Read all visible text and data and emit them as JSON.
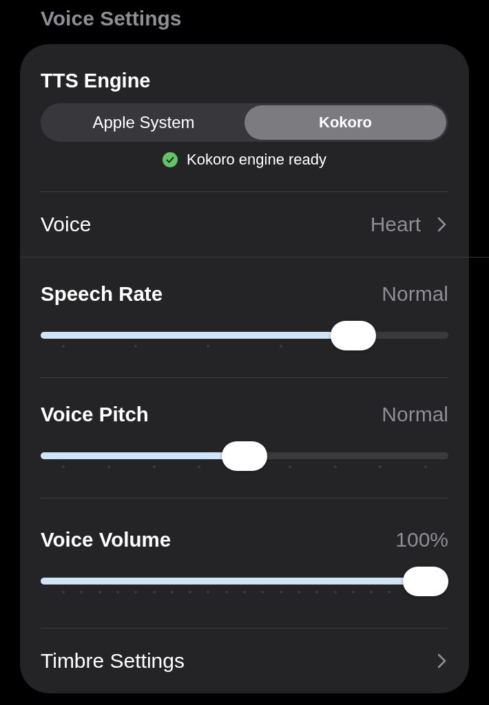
{
  "header": {
    "title": "Voice Settings"
  },
  "engine": {
    "label": "TTS Engine",
    "options": [
      {
        "label": "Apple System",
        "selected": false
      },
      {
        "label": "Kokoro",
        "selected": true
      }
    ],
    "status": {
      "kind": "ready",
      "text": "Kokoro engine ready"
    }
  },
  "voice": {
    "label": "Voice",
    "value": "Heart"
  },
  "sliders": [
    {
      "label": "Speech Rate",
      "reading": "Normal",
      "level": 0.8,
      "kind": "fifths"
    },
    {
      "label": "Voice Pitch",
      "reading": "Normal",
      "level": 0.5,
      "kind": "eighths"
    },
    {
      "label": "Voice Volume",
      "reading": "100%",
      "level": 1,
      "kind": "twentieths"
    }
  ],
  "timbre": {
    "label": "Timbre Settings"
  }
}
